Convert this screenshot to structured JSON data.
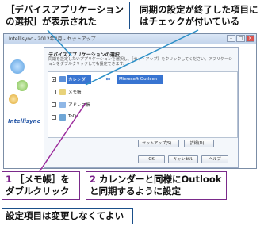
{
  "callouts": {
    "top_left": "［デバイスアプリケーションの選択］が表示された",
    "top_right": "同期の設定が終了した項目にはチェックが付いている",
    "step1_num": "1",
    "step1_text": "［メモ帳］をダブルクリック",
    "step2_num": "2",
    "step2_text": "カレンダーと同様にOutlookと同期するように設定",
    "note": "設定項目は変更しなくてよい"
  },
  "window": {
    "title": "Intellisync - 2012年4月 - セットアップ",
    "brand": "Intellisync"
  },
  "dialog": {
    "title": "デバイスアプリケーションの選択",
    "description": "同期を設定したいアプリケーションを選択し、［セットアップ］をクリックしてください。アプリケーションをダブルクリックしても設定できます。",
    "items": [
      {
        "label": "カレンダー",
        "checked": true,
        "target": "Microsoft Outlook"
      },
      {
        "label": "メモ帳",
        "checked": false
      },
      {
        "label": "アドレス帳",
        "checked": false
      },
      {
        "label": "ToDo",
        "checked": false
      }
    ],
    "buttons": {
      "setup": "セットアップ(S)...",
      "details": "詳細(D)...",
      "ok": "OK",
      "cancel": "キャンセル",
      "help": "ヘルプ"
    }
  },
  "colors": {
    "accent": "#3874d1",
    "callout_border": "#1a4f8a",
    "step_number": "#7a1f8a",
    "pointer_line": "#2b8fc7"
  }
}
